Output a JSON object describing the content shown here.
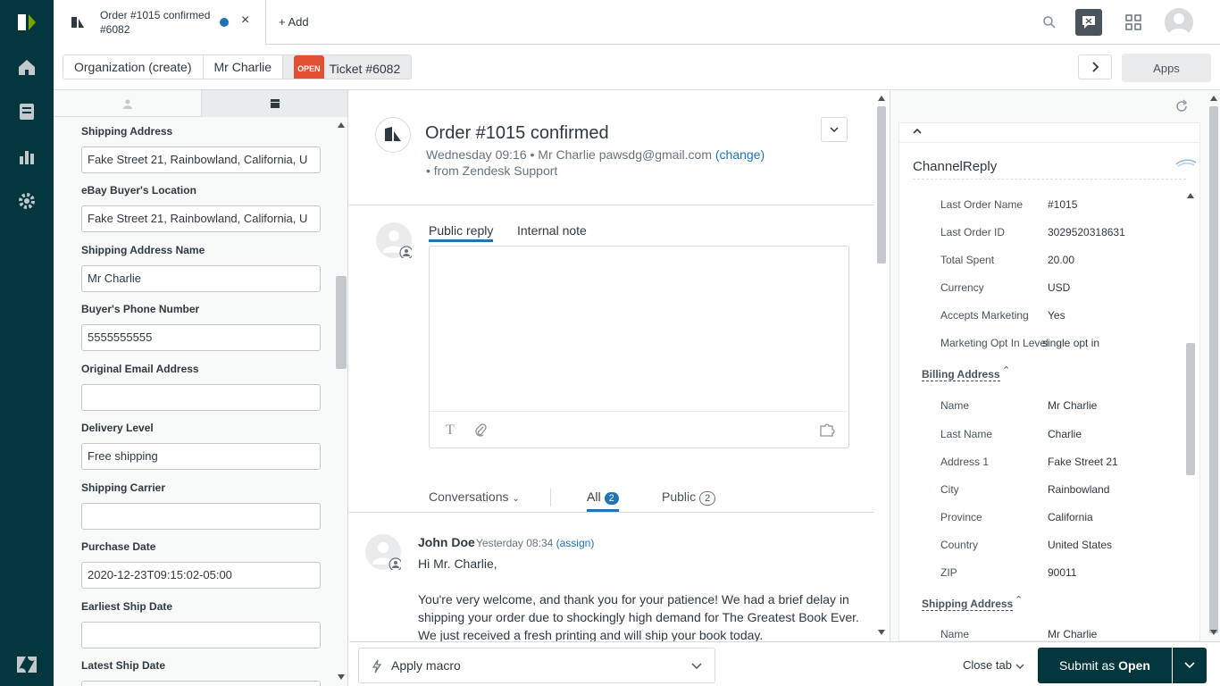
{
  "tab": {
    "title_line1": "Order #1015 confirmed",
    "title_line2": "#6082",
    "close": "×"
  },
  "add_label": "Add",
  "breadcrumbs": {
    "org": "Organization (create)",
    "requester": "Mr Charlie",
    "status_badge": "OPEN",
    "ticket": "Ticket #6082"
  },
  "apps_label": "Apps",
  "left_fields": [
    {
      "label": "Shipping Address",
      "value": "Fake Street 21, Rainbowland, California, U"
    },
    {
      "label": "eBay Buyer's Location",
      "value": "Fake Street 21, Rainbowland, California, U"
    },
    {
      "label": "Shipping Address Name",
      "value": "Mr Charlie"
    },
    {
      "label": "Buyer's Phone Number",
      "value": "5555555555"
    },
    {
      "label": "Original Email Address",
      "value": ""
    },
    {
      "label": "Delivery Level",
      "value": "Free shipping"
    },
    {
      "label": "Shipping Carrier",
      "value": ""
    },
    {
      "label": "Purchase Date",
      "value": "2020-12-23T09:15:02-05:00"
    },
    {
      "label": "Earliest Ship Date",
      "value": ""
    },
    {
      "label": "Latest Ship Date",
      "value": ""
    }
  ],
  "ticket": {
    "title": "Order #1015 confirmed",
    "meta": "Wednesday 09:16 • Mr Charlie  pawsdg@gmail.com",
    "change": "(change)",
    "source": "• from Zendesk Support"
  },
  "reply_tabs": {
    "public": "Public reply",
    "internal": "Internal note"
  },
  "conv": {
    "conversations": "Conversations",
    "all": "All",
    "all_count": "2",
    "public": "Public",
    "public_count": "2"
  },
  "message": {
    "author": "John Doe",
    "time": "Yesterday 08:34",
    "assign": "(assign)",
    "greeting": "Hi Mr. Charlie,",
    "body": "You're very welcome, and thank you for your patience! We had a brief delay in shipping your order due to shockingly high demand for The Greatest Book Ever. We just received a fresh printing and will ship your book today."
  },
  "bottom": {
    "macro": "Apply macro",
    "close_tab": "Close tab",
    "submit_prefix": "Submit as ",
    "submit_status": "Open"
  },
  "app": {
    "name": "ChannelReply",
    "order_fields": [
      {
        "k": "Last Order Name",
        "v": "#1015"
      },
      {
        "k": "Last Order ID",
        "v": "3029520318631"
      },
      {
        "k": "Total Spent",
        "v": "20.00"
      },
      {
        "k": "Currency",
        "v": "USD"
      },
      {
        "k": "Accepts Marketing",
        "v": "Yes"
      },
      {
        "k": "Marketing Opt In Level",
        "v": "single opt in"
      }
    ],
    "billing_title": "Billing Address",
    "billing": [
      {
        "k": "Name",
        "v": "Mr Charlie"
      },
      {
        "k": "Last Name",
        "v": "Charlie"
      },
      {
        "k": "Address 1",
        "v": "Fake Street 21"
      },
      {
        "k": "City",
        "v": "Rainbowland"
      },
      {
        "k": "Province",
        "v": "California"
      },
      {
        "k": "Country",
        "v": "United States"
      },
      {
        "k": "ZIP",
        "v": "90011"
      }
    ],
    "shipping_title": "Shipping Address",
    "shipping": [
      {
        "k": "Name",
        "v": "Mr Charlie"
      }
    ]
  },
  "colors": {
    "rail": "#03363d",
    "accent": "#1f73b7",
    "open_badge": "#e34f32"
  }
}
